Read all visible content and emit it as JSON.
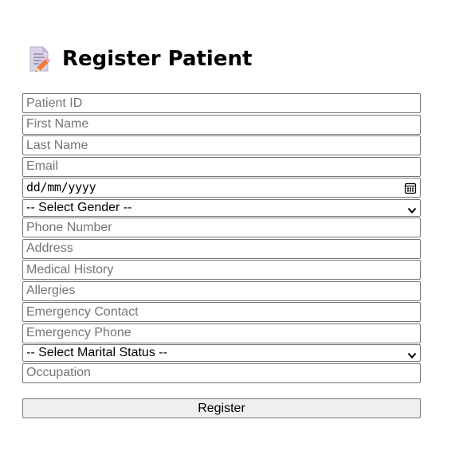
{
  "header": {
    "title": "Register Patient",
    "icon": "memo-icon"
  },
  "form": {
    "patient_id": {
      "placeholder": "Patient ID",
      "value": ""
    },
    "first_name": {
      "placeholder": "First Name",
      "value": ""
    },
    "last_name": {
      "placeholder": "Last Name",
      "value": ""
    },
    "email": {
      "placeholder": "Email",
      "value": ""
    },
    "date_of_birth": {
      "display": "dd/mm/yyyy",
      "icon": "calendar-icon"
    },
    "gender": {
      "selected": "-- Select Gender --",
      "icon": "chevron-down-icon"
    },
    "phone": {
      "placeholder": "Phone Number",
      "value": ""
    },
    "address": {
      "placeholder": "Address",
      "value": ""
    },
    "medical_history": {
      "placeholder": "Medical History",
      "value": ""
    },
    "allergies": {
      "placeholder": "Allergies",
      "value": ""
    },
    "emergency_contact": {
      "placeholder": "Emergency Contact",
      "value": ""
    },
    "emergency_phone": {
      "placeholder": "Emergency Phone",
      "value": ""
    },
    "marital_status": {
      "selected": "-- Select Marital Status --",
      "icon": "chevron-down-icon"
    },
    "occupation": {
      "placeholder": "Occupation",
      "value": ""
    }
  },
  "actions": {
    "register_label": "Register"
  },
  "colors": {
    "border": "#767676",
    "placeholder": "#757575",
    "button_bg": "#efefef",
    "icon_paper": "#d9d3e6",
    "icon_pencil": "#f07a3c"
  }
}
